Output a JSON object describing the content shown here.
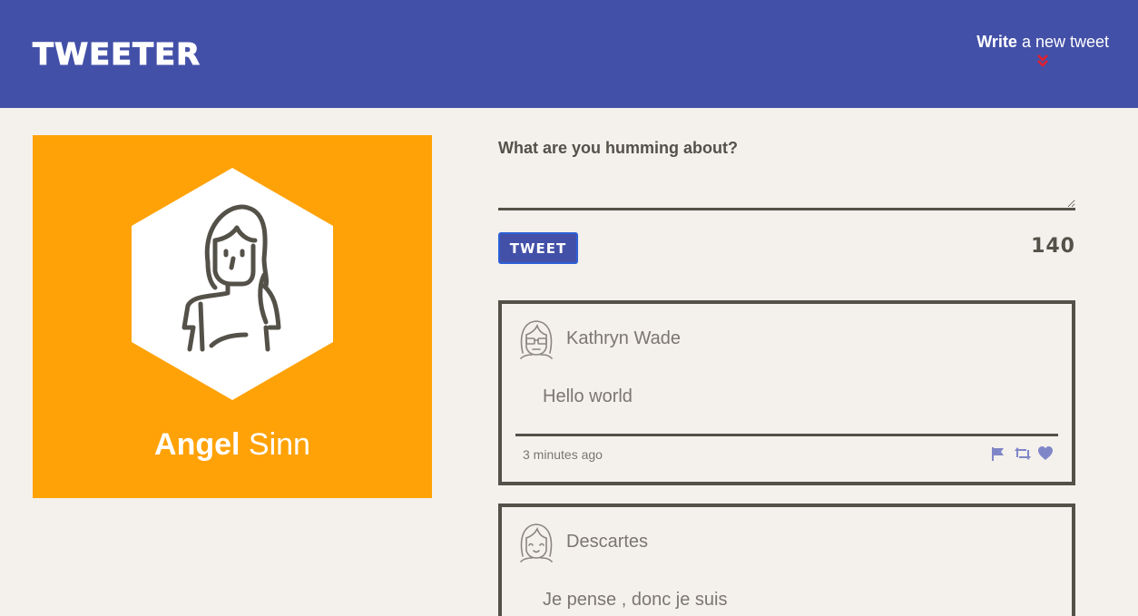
{
  "nav": {
    "brand": "TWEETER",
    "compose_toggle": {
      "bold": "Write",
      "rest": " a new tweet",
      "icon": "double-chevron-down-icon",
      "icon_color": "#e0202f"
    }
  },
  "profile": {
    "first_name": "Angel",
    "last_name": " Sinn",
    "background": "#ffa207",
    "avatar_icon": "user-avatar-icon"
  },
  "compose": {
    "label": "What are you humming about?",
    "value": "",
    "button_label": "TWEET",
    "counter": "140"
  },
  "tweets": [
    {
      "author": "Kathryn Wade",
      "avatar_icon": "avatar-glasses-icon",
      "content": "Hello world",
      "timestamp": "3 minutes ago",
      "actions": [
        "flag-icon",
        "retweet-icon",
        "heart-icon"
      ]
    },
    {
      "author": "Descartes",
      "avatar_icon": "avatar-smile-icon",
      "content": "Je pense , donc je suis"
    }
  ],
  "colors": {
    "nav": "#4350a8",
    "background": "#f4f0ec",
    "text": "#545149",
    "action_icons": "#7f86c8"
  }
}
